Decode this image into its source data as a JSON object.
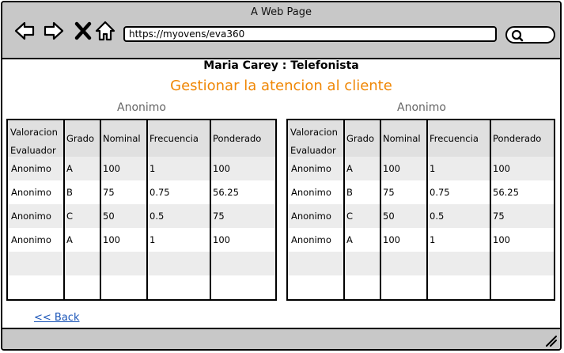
{
  "window": {
    "title": "A Web Page"
  },
  "browser": {
    "url": "https://myovens/eva360"
  },
  "page": {
    "title": "Maria Carey : Telefonista",
    "subtitle": "Gestionar la atencion al cliente"
  },
  "colors": {
    "subtitle": "#f08705",
    "chrome": "#c8c8c8",
    "link": "#1a55b8",
    "row_alt": "#ececec"
  },
  "tables": [
    {
      "caption": "Anonimo",
      "headers": {
        "valoracion": "Valoracion",
        "evaluador": "Evaluador",
        "grado": "Grado",
        "nominal": "Nominal",
        "frecuencia": "Frecuencia",
        "ponderado": "Ponderado"
      },
      "rows": [
        [
          "Anonimo",
          "A",
          "100",
          "1",
          "100"
        ],
        [
          "Anonimo",
          "B",
          "75",
          "0.75",
          "56.25"
        ],
        [
          "Anonimo",
          "C",
          "50",
          "0.5",
          "75"
        ],
        [
          "Anonimo",
          "A",
          "100",
          "1",
          "100"
        ]
      ]
    },
    {
      "caption": "Anonimo",
      "headers": {
        "valoracion": "Valoracion",
        "evaluador": "Evaluador",
        "grado": "Grado",
        "nominal": "Nominal",
        "frecuencia": "Frecuencia",
        "ponderado": "Ponderado"
      },
      "rows": [
        [
          "Anonimo",
          "A",
          "100",
          "1",
          "100"
        ],
        [
          "Anonimo",
          "B",
          "75",
          "0.75",
          "56.25"
        ],
        [
          "Anonimo",
          "C",
          "50",
          "0.5",
          "75"
        ],
        [
          "Anonimo",
          "A",
          "100",
          "1",
          "100"
        ]
      ]
    }
  ],
  "back_link": "<< Back",
  "icons": [
    "back-arrow-icon",
    "forward-arrow-icon",
    "close-icon",
    "home-icon",
    "search-icon",
    "resize-grip-icon"
  ]
}
